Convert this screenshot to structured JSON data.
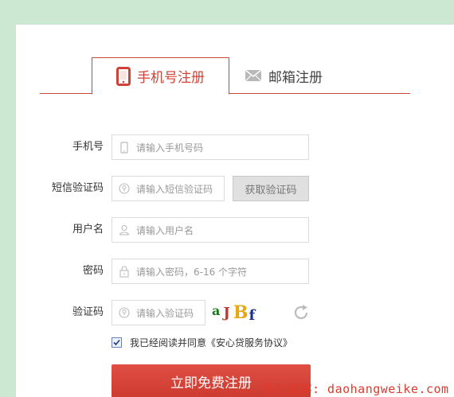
{
  "tabs": {
    "phone": {
      "label": "手机号注册",
      "icon": "mobile-phone-icon",
      "active": true
    },
    "email": {
      "label": "邮箱注册",
      "icon": "envelope-icon",
      "active": false
    }
  },
  "form": {
    "phone": {
      "label": "手机号",
      "placeholder": "请输入手机号码",
      "icon": "mobile-phone-icon"
    },
    "sms_code": {
      "label": "短信验证码",
      "placeholder": "请输入短信验证码",
      "icon": "lightbulb-icon",
      "button_label": "获取验证码"
    },
    "username": {
      "label": "用户名",
      "placeholder": "请输入用户名",
      "icon": "user-icon"
    },
    "password": {
      "label": "密码",
      "placeholder": "请输入密码，6-16 个字符",
      "icon": "lock-icon"
    },
    "captcha": {
      "label": "验证码",
      "placeholder": "请输入验证码",
      "icon": "lightbulb-icon",
      "chars": [
        "a",
        "J",
        "B",
        "f"
      ],
      "refresh_icon": "refresh-icon"
    }
  },
  "agreement": {
    "checked": true,
    "text": "我已经阅读并同意《安心贷服务协议》"
  },
  "submit_label": "立即免费注册",
  "watermark": "导航威客: daohangweike.com",
  "colors": {
    "accent": "#d24135",
    "background": "#cde8d2"
  }
}
